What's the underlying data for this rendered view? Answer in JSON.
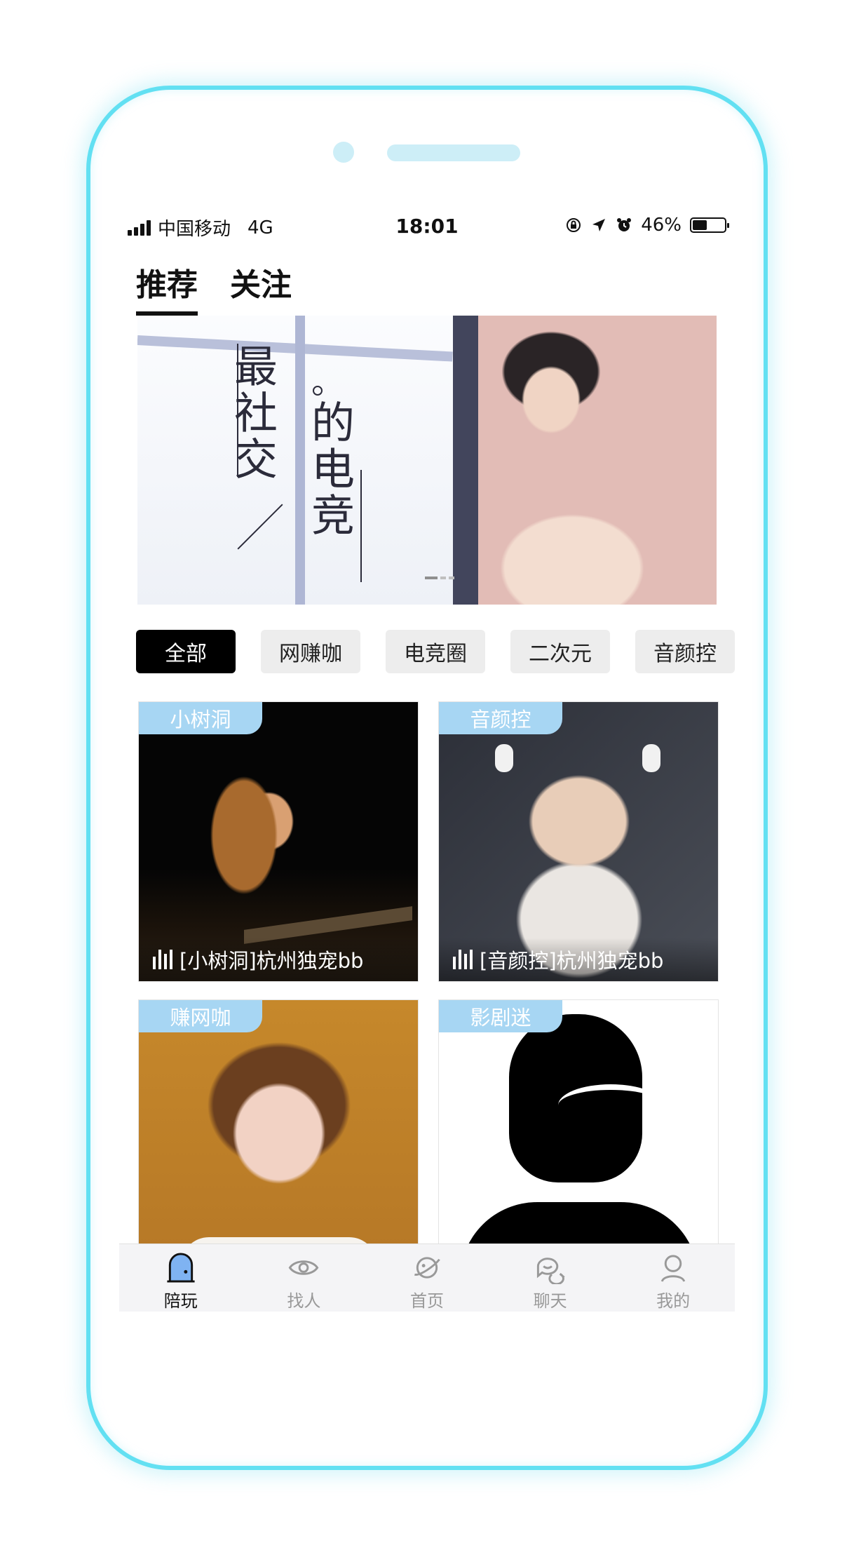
{
  "status_bar": {
    "carrier": "中国移动",
    "network": "4G",
    "time": "18:01",
    "battery": "46%",
    "battery_level": 0.46
  },
  "top_tabs": [
    {
      "label": "推荐",
      "active": true
    },
    {
      "label": "关注",
      "active": false
    }
  ],
  "banner": {
    "slogan_line1": "最社交",
    "slogan_line2": "的电竞"
  },
  "categories": [
    {
      "label": "全部",
      "active": true
    },
    {
      "label": "网赚咖",
      "active": false
    },
    {
      "label": "电竞圈",
      "active": false
    },
    {
      "label": "二次元",
      "active": false
    },
    {
      "label": "音颜控",
      "active": false
    }
  ],
  "cards": [
    {
      "tag": "小树洞",
      "title": "[小树洞]杭州独宠bb"
    },
    {
      "tag": "音颜控",
      "title": "[音颜控]杭州独宠bb"
    },
    {
      "tag": "赚网咖",
      "title": ""
    },
    {
      "tag": "影剧迷",
      "title": ""
    }
  ],
  "bottom_nav": [
    {
      "label": "陪玩",
      "icon": "door-icon",
      "active": true
    },
    {
      "label": "找人",
      "icon": "eye-icon",
      "active": false
    },
    {
      "label": "首页",
      "icon": "planet-icon",
      "active": false
    },
    {
      "label": "聊天",
      "icon": "chat-icon",
      "active": false
    },
    {
      "label": "我的",
      "icon": "person-icon",
      "active": false
    }
  ],
  "colors": {
    "frame": "#62e0f2",
    "tag_bg": "#a7d6f3",
    "chip_active": "#000000",
    "chip_inactive": "#ededed"
  }
}
